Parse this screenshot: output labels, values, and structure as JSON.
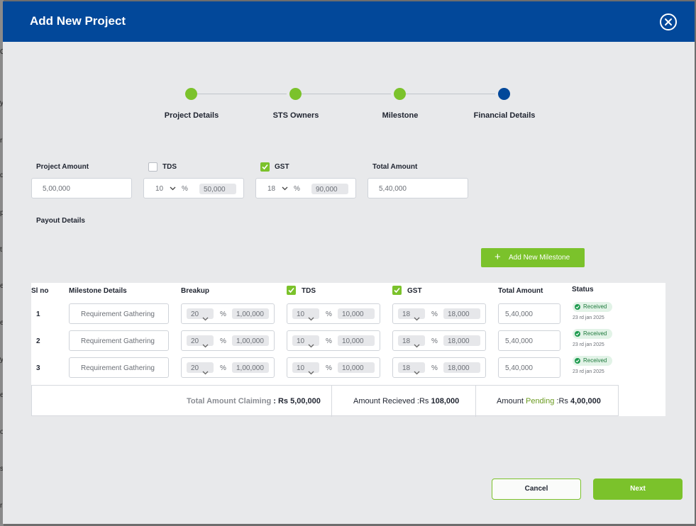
{
  "modal": {
    "title": "Add New Project"
  },
  "stepper": {
    "steps": [
      {
        "label": "Project Details",
        "state": "done"
      },
      {
        "label": "STS Owners",
        "state": "done"
      },
      {
        "label": "Milestone",
        "state": "done"
      },
      {
        "label": "Financial Details",
        "state": "active"
      }
    ]
  },
  "form": {
    "project_amount": {
      "label": "Project Amount",
      "value": "5,00,000"
    },
    "tds": {
      "label": "TDS",
      "checked": false,
      "rate": "10",
      "percent_sign": "%",
      "amount": "50,000"
    },
    "gst": {
      "label": "GST",
      "checked": true,
      "rate": "18",
      "percent_sign": "%",
      "amount": "90,000"
    },
    "total_amount": {
      "label": "Total Amount",
      "value": "5,40,000"
    }
  },
  "payout": {
    "title": "Payout Details",
    "add_button": "Add New Milestone",
    "columns": {
      "sl_no": "Sl no",
      "milestone": "Milestone Details",
      "breakup": "Breakup",
      "tds": "TDS",
      "gst": "GST",
      "total": "Total Amount",
      "status": "Status"
    },
    "rows": [
      {
        "no": "1",
        "milestone": "Requirement Gathering",
        "breakup_pct": "20",
        "breakup_amt": "1,00,000",
        "tds_pct": "10",
        "tds_amt": "10,000",
        "gst_pct": "18",
        "gst_amt": "18,000",
        "total": "5,40,000",
        "status": "Received",
        "date": "23 rd jan 2025"
      },
      {
        "no": "2",
        "milestone": "Requirement Gathering",
        "breakup_pct": "20",
        "breakup_amt": "1,00,000",
        "tds_pct": "10",
        "tds_amt": "10,000",
        "gst_pct": "18",
        "gst_amt": "18,000",
        "total": "5,40,000",
        "status": "Received",
        "date": "23 rd jan 2025"
      },
      {
        "no": "3",
        "milestone": "Requirement Gathering",
        "breakup_pct": "20",
        "breakup_amt": "1,00,000",
        "tds_pct": "10",
        "tds_amt": "10,000",
        "gst_pct": "18",
        "gst_amt": "18,000",
        "total": "5,40,000",
        "status": "Received",
        "date": "23 rd jan 2025"
      }
    ],
    "totals": {
      "claiming_label": "Total Amount Claiming",
      "claiming_value": "Rs 5,00,000",
      "received_label": "Amount Recieved",
      "received_value": "108,000",
      "pending_prefix": "Amount",
      "pending_word": "Pending",
      "pending_value": "4,00,000",
      "currency": "Rs",
      "separator": ":"
    }
  },
  "actions": {
    "cancel": "Cancel",
    "next": "Next"
  },
  "backdrop": {
    "chars": [
      "C",
      "y",
      "r",
      "d",
      "p",
      "t",
      "e",
      "e",
      "y",
      "e",
      "o",
      "s",
      "r"
    ]
  },
  "colors": {
    "header": "#02489a",
    "accent_green": "#7bc22b",
    "pending_text": "#6a9a1f"
  }
}
